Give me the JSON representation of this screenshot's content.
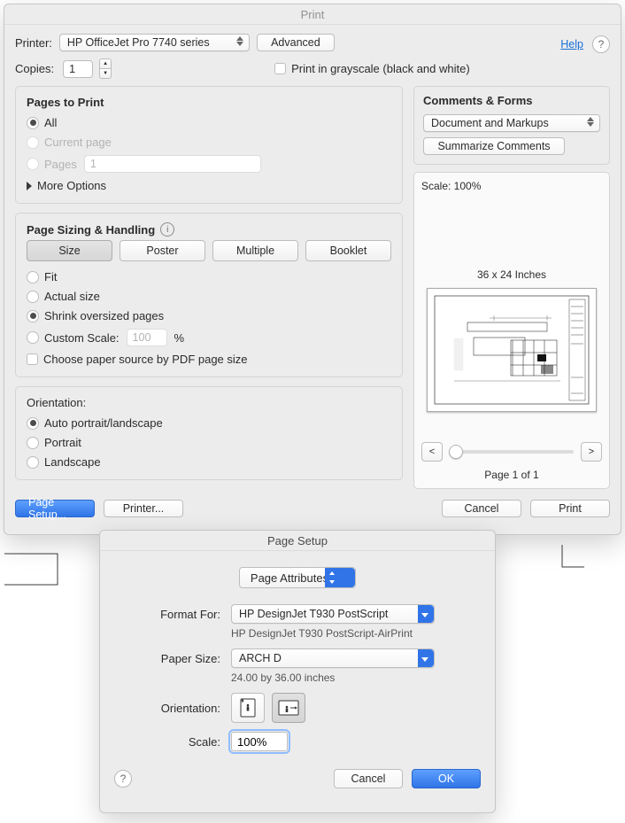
{
  "print": {
    "window_title": "Print",
    "printer_label": "Printer:",
    "printer_value": "HP OfficeJet Pro 7740 series",
    "advanced_label": "Advanced",
    "help_label": "Help",
    "copies_label": "Copies:",
    "copies_value": "1",
    "grayscale_label": "Print in grayscale (black and white)"
  },
  "pages": {
    "title": "Pages to Print",
    "all": "All",
    "current": "Current page",
    "pages_label": "Pages",
    "pages_value": "1",
    "more_options": "More Options"
  },
  "sizing": {
    "title": "Page Sizing & Handling",
    "tabs": {
      "size": "Size",
      "poster": "Poster",
      "multiple": "Multiple",
      "booklet": "Booklet"
    },
    "fit": "Fit",
    "actual": "Actual size",
    "shrink": "Shrink oversized pages",
    "custom": "Custom Scale:",
    "custom_value": "100",
    "percent": "%",
    "choose_source": "Choose paper source by PDF page size"
  },
  "orientation": {
    "title": "Orientation:",
    "auto": "Auto portrait/landscape",
    "portrait": "Portrait",
    "landscape": "Landscape"
  },
  "comments": {
    "title": "Comments & Forms",
    "select_value": "Document and Markups",
    "summarize": "Summarize Comments"
  },
  "preview": {
    "scale_text": "Scale: 100%",
    "dimensions": "36 x 24 Inches",
    "page_indicator": "Page 1 of 1",
    "prev": "<",
    "next": ">"
  },
  "footer": {
    "page_setup": "Page Setup...",
    "printer_btn": "Printer...",
    "cancel": "Cancel",
    "print": "Print"
  },
  "page_setup": {
    "window_title": "Page Setup",
    "tab": "Page Attributes",
    "format_for_label": "Format For:",
    "format_for_value": "HP DesignJet T930 PostScript",
    "format_for_sub": "HP DesignJet T930 PostScript-AirPrint",
    "paper_size_label": "Paper Size:",
    "paper_size_value": "ARCH D",
    "paper_size_sub": "24.00 by 36.00 inches",
    "orientation_label": "Orientation:",
    "scale_label": "Scale:",
    "scale_value": "100%",
    "cancel": "Cancel",
    "ok": "OK"
  }
}
